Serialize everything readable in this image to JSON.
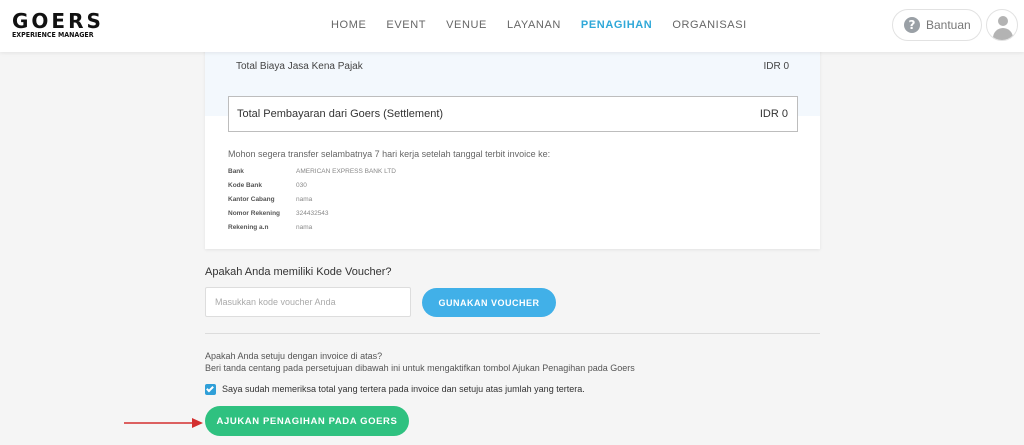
{
  "header": {
    "logo_main": "GOERS",
    "logo_sub": "EXPERIENCE MANAGER",
    "nav": [
      "HOME",
      "EVENT",
      "VENUE",
      "LAYANAN",
      "PENAGIHAN",
      "ORGANISASI"
    ],
    "active_nav": "PENAGIHAN",
    "help_icon": "?",
    "help_label": "Bantuan"
  },
  "invoice": {
    "tax_label": "Total Biaya Jasa Kena Pajak",
    "tax_value": "IDR 0",
    "settlement_label": "Total Pembayaran dari Goers (Settlement)",
    "settlement_value": "IDR 0",
    "transfer_note": "Mohon segera transfer selambatnya 7 hari kerja setelah tanggal terbit invoice ke:",
    "bank": [
      {
        "key": "Bank",
        "value": "AMERICAN EXPRESS BANK LTD"
      },
      {
        "key": "Kode Bank",
        "value": "030"
      },
      {
        "key": "Kantor Cabang",
        "value": "nama"
      },
      {
        "key": "Nomor Rekening",
        "value": "324432543"
      },
      {
        "key": "Rekening a.n",
        "value": "nama"
      }
    ]
  },
  "voucher": {
    "question": "Apakah Anda memiliki Kode Voucher?",
    "input_placeholder": "Masukkan kode voucher Anda",
    "input_value": "",
    "button_label": "GUNAKAN VOUCHER"
  },
  "agreement": {
    "question": "Apakah Anda setuju dengan invoice di atas?",
    "hint": "Beri tanda centang pada persetujuan dibawah ini untuk mengaktifkan tombol Ajukan Penagihan pada Goers",
    "checkbox_checked": true,
    "checkbox_label": "Saya sudah memeriksa total yang tertera pada invoice dan setuju atas jumlah yang tertera.",
    "submit_label": "AJUKAN PENAGIHAN PADA GOERS"
  },
  "colors": {
    "nav_active": "#2fa8d8",
    "voucher_button": "#41b0e8",
    "submit_button": "#2fc180",
    "checkbox": "#2f9fd8",
    "arrow": "#d32f2f"
  }
}
